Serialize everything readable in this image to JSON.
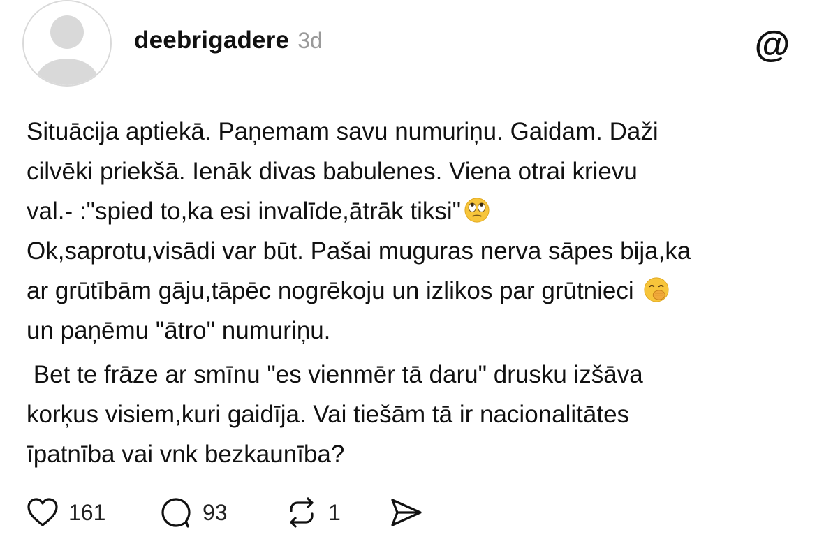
{
  "post": {
    "username": "deebrigadere",
    "time_ago": "3d",
    "paragraph1": {
      "line1": "Situācija aptiekā. Paņemam savu numuriņu. Gaidam. Daži",
      "line2": "cilvēki priekšā. Ienāk divas babulenes. Viena otrai krievu",
      "line3": "val.- :\"spied to,ka esi invalīde,ātrāk tiksi\"",
      "line4": "Ok,saprotu,visādi var būt. Pašai muguras nerva sāpes bija,ka",
      "line5": "ar grūtībām gāju,tāpēc nogrēkoju un izlikos par grūtnieci ",
      "line6": "un paņēmu \"ātro\" numuriņu."
    },
    "paragraph2": {
      "line1": " Bet te frāze ar smīnu \"es vienmēr tā daru\" drusku izšāva",
      "line2": "korķus visiem,kuri gaidīja. Vai tiešām tā ir nacionalitātes",
      "line3": "īpatnība vai vnk bezkaunība?"
    },
    "emojis": [
      "eye-roll-emoji",
      "hand-over-mouth-emoji"
    ]
  },
  "actions": {
    "likes": "161",
    "replies": "93",
    "reposts": "1"
  },
  "icons": {
    "avatar": "default-avatar-icon",
    "logo": "threads-logo-icon",
    "like": "heart-icon",
    "reply": "speech-bubble-icon",
    "repost": "repost-icon",
    "share": "send-icon"
  },
  "colors": {
    "text": "#111111",
    "muted": "#9a9a9a",
    "avatar_fill": "#d9d9d9",
    "emoji_yellow": "#f7c53b"
  }
}
